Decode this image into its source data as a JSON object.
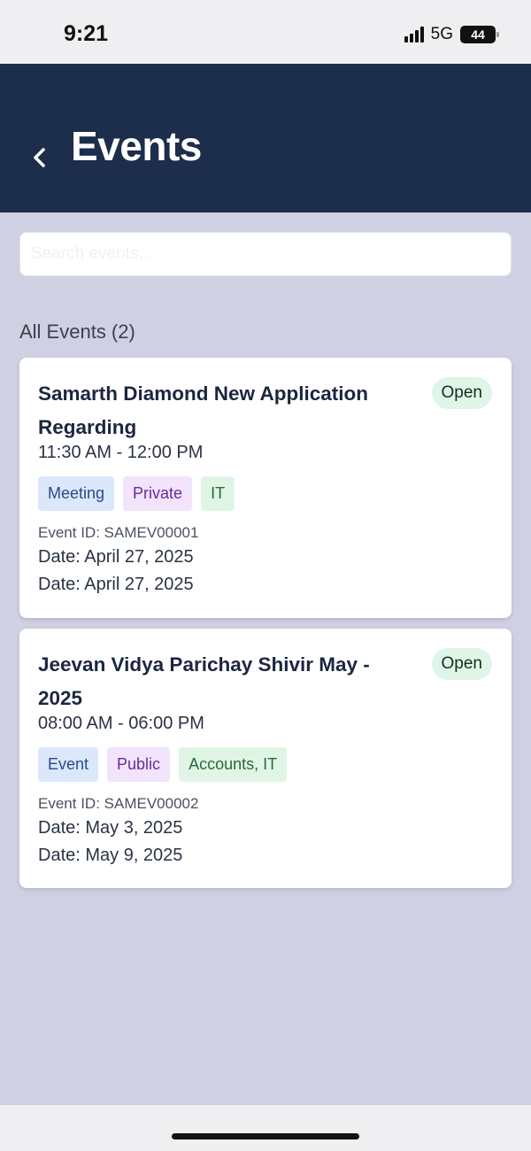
{
  "status_bar": {
    "time": "9:21",
    "network": "5G",
    "battery": "44",
    "signal_icon": "signal-bars-icon",
    "battery_icon": "battery-icon"
  },
  "header": {
    "back_icon": "chevron-left-icon",
    "title": "Events"
  },
  "search": {
    "placeholder": "Search events...",
    "value": ""
  },
  "section_heading": "All Events (2)",
  "events": [
    {
      "title": "Samarth Diamond New Application Regarding",
      "status": "Open",
      "time": "11:30 AM - 12:00 PM",
      "tags": [
        "Meeting",
        "Private",
        "IT"
      ],
      "event_id": "Event ID: SAMEV00001",
      "date_start": "Date: April 27, 2025",
      "date_end": "Date: April 27, 2025"
    },
    {
      "title": "Jeevan Vidya Parichay Shivir May - 2025",
      "status": "Open",
      "time": "08:00 AM - 06:00 PM",
      "tags": [
        "Event",
        "Public",
        "Accounts, IT"
      ],
      "event_id": "Event ID: SAMEV00002",
      "date_start": "Date: May 3, 2025",
      "date_end": "Date: May 9, 2025"
    }
  ],
  "colors": {
    "header_bg": "#1d2d4c",
    "content_bg": "#cfd0e2",
    "status_open_bg": "#dff5e7",
    "tag_blue_bg": "#dbe8fb",
    "tag_purple_bg": "#f1e4fb",
    "tag_green_bg": "#e0f5e6"
  }
}
